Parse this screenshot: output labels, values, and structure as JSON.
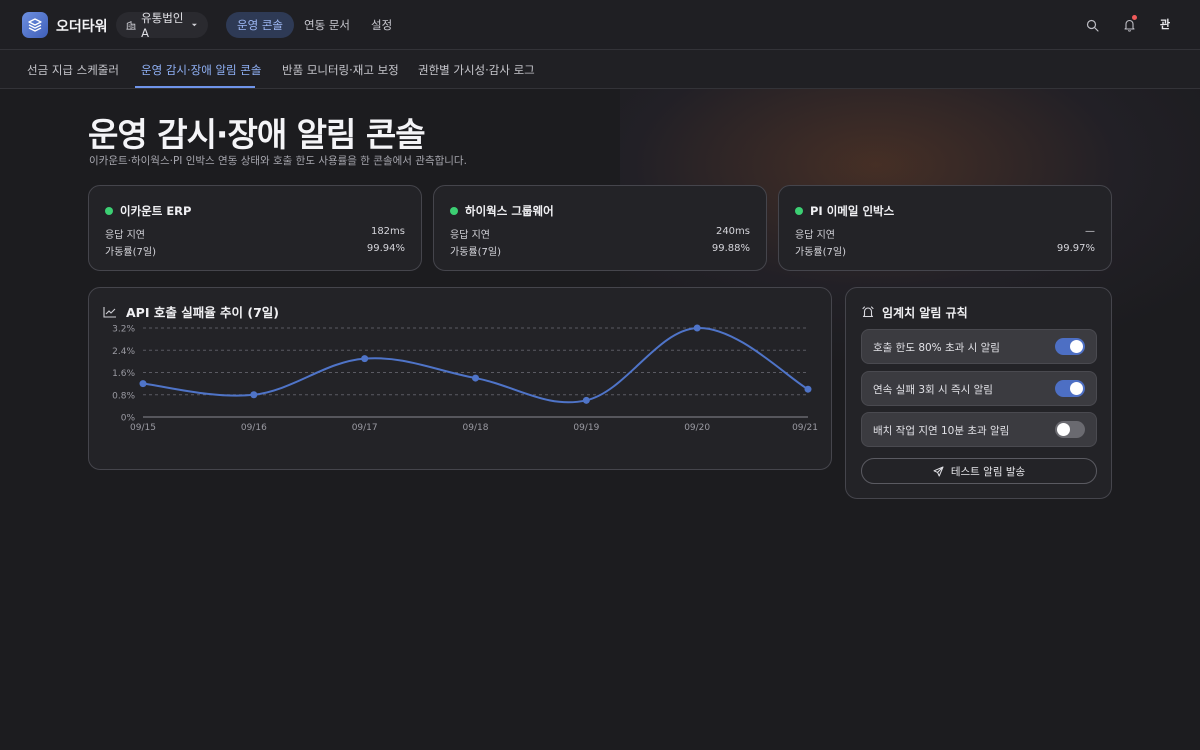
{
  "app": {
    "brand": "오더타워",
    "corp_selector": "유통법인 A"
  },
  "nav": [
    {
      "label": "운영 콘솔",
      "active": true
    },
    {
      "label": "연동 문서",
      "active": false
    },
    {
      "label": "설정",
      "active": false
    }
  ],
  "user": {
    "avatar": "관"
  },
  "subtabs": [
    {
      "label": "선금 지급 스케줄러",
      "active": false
    },
    {
      "label": "운영 감시·장애 알림 콘솔",
      "active": true
    },
    {
      "label": "반품 모니터링·재고 보정",
      "active": false
    },
    {
      "label": "권한별 가시성·감사 로그",
      "active": false
    }
  ],
  "page": {
    "title": "운영 감시·장애 알림 콘솔",
    "subtitle": "이카운트·하이웍스·PI 인박스 연동 상태와 호출 한도 사용률을 한 콘솔에서 관측합니다."
  },
  "systems": [
    {
      "name": "이카운트 ERP",
      "status_color": "#3ccf73",
      "latency_label": "응답 지연",
      "latency": "182ms",
      "uptime_label": "가동률(7일)",
      "uptime": "99.94%"
    },
    {
      "name": "하이웍스 그룹웨어",
      "status_color": "#3ccf73",
      "latency_label": "응답 지연",
      "latency": "240ms",
      "uptime_label": "가동률(7일)",
      "uptime": "99.88%"
    },
    {
      "name": "PI 이메일 인박스",
      "status_color": "#3ccf73",
      "latency_label": "응답 지연",
      "latency": "—",
      "uptime_label": "가동률(7일)",
      "uptime": "99.97%"
    }
  ],
  "chart_card": {
    "title": "API 호출 실패율 추이 (7일)"
  },
  "chart_data": {
    "type": "line",
    "title": "API 호출 실패율 추이 (7일)",
    "categories": [
      "09/15",
      "09/16",
      "09/17",
      "09/18",
      "09/19",
      "09/20",
      "09/21"
    ],
    "series": [
      {
        "values": [
          1.2,
          0.8,
          2.1,
          1.4,
          0.6,
          3.2,
          1.0
        ],
        "color": "#4f74c8"
      }
    ],
    "y_ticks": [
      "0%",
      "0.8%",
      "1.6%",
      "2.4%",
      "3.2%"
    ],
    "ylim": [
      0,
      3.2
    ],
    "grid": true
  },
  "rules": {
    "title": "임계치 알림 규칙",
    "items": [
      {
        "label": "호출 한도 80% 초과 시 알림",
        "enabled": true
      },
      {
        "label": "연속 실패 3회 시 즉시 알림",
        "enabled": true
      },
      {
        "label": "배치 작업 지연 10분 초과 알림",
        "enabled": false
      }
    ],
    "test_button": "테스트 알림 발송"
  },
  "colors": {
    "accent": "#4d6fc4",
    "status_ok": "#3ccf73",
    "notification_dot": "#ef5a5a"
  }
}
